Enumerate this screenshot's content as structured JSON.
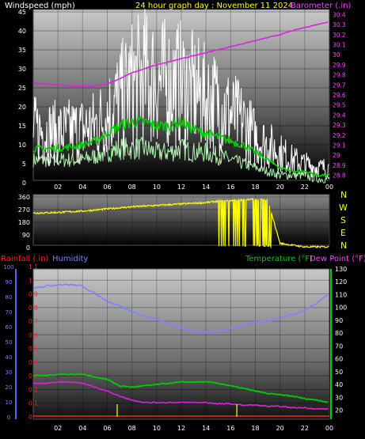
{
  "header": {
    "left_label": "Windspeed (mph)",
    "center_label": "24 hour graph day : November 11 2024",
    "right_label": "Barometer (.in)"
  },
  "mid": {
    "compass_labels": [
      "N",
      "W",
      "S",
      "E",
      "N"
    ]
  },
  "bottom": {
    "rain_label": "Rainfall (.in)",
    "hum_label": "Humidity",
    "temp_label": "Temperature (°F)",
    "dew_label": "Dew Point (°F)"
  },
  "colors": {
    "wind_gust": "#ffffff",
    "wind_avg": "#00cc00",
    "wind_low": "#b0f0b0",
    "barometer": "#e020e0",
    "direction": "#ffff00",
    "humidity": "#8080ff",
    "temperature": "#00cc00",
    "dewpoint": "#e020e0",
    "rain": "#ff2020",
    "rainbars": "#ffff00"
  },
  "chart_data": [
    {
      "type": "line",
      "title": "24 hour graph day : November 11 2024",
      "x_ticks": [
        "02",
        "04",
        "06",
        "08",
        "10",
        "12",
        "14",
        "16",
        "18",
        "20",
        "22",
        "00"
      ],
      "left_axis": {
        "label": "Windspeed (mph)",
        "ticks": [
          0,
          5,
          10,
          15,
          20,
          25,
          30,
          35,
          40,
          45
        ],
        "range": [
          0,
          45
        ]
      },
      "right_axis": {
        "label": "Barometer (.in)",
        "ticks": [
          28.8,
          28.9,
          29,
          29.1,
          29.2,
          29.3,
          29.4,
          29.5,
          29.6,
          29.7,
          29.8,
          29.9,
          30,
          30.1,
          30.2,
          30.3,
          30.4
        ],
        "range": [
          28.75,
          30.45
        ]
      },
      "series": [
        {
          "x": [
            0,
            2,
            4,
            5,
            6,
            7,
            8,
            9,
            10,
            11,
            12,
            13,
            14,
            15,
            16,
            17,
            18,
            19,
            20,
            21,
            22,
            23,
            24
          ],
          "values": [
            14,
            13,
            14,
            15,
            18,
            22,
            26,
            28,
            27,
            26,
            26,
            24,
            22,
            21,
            18,
            16,
            12,
            10,
            8,
            6,
            5,
            4,
            4
          ]
        },
        {
          "x": [
            0,
            2,
            4,
            5,
            6,
            7,
            8,
            9,
            10,
            11,
            12,
            13,
            14,
            15,
            16,
            17,
            18,
            19,
            20,
            21,
            22,
            23,
            24
          ],
          "values": [
            9,
            9,
            10,
            11,
            13,
            15,
            16,
            16,
            15,
            15,
            16,
            14,
            13,
            12,
            11,
            10,
            8,
            6,
            4,
            3,
            3,
            2,
            2
          ]
        },
        {
          "x": [
            0,
            2,
            4,
            5,
            6,
            7,
            8,
            9,
            10,
            11,
            12,
            13,
            14,
            15,
            16,
            17,
            18,
            19,
            20,
            21,
            22,
            23,
            24
          ],
          "values": [
            6,
            6,
            6,
            7,
            8,
            9,
            9,
            9,
            8,
            8,
            9,
            8,
            8,
            7,
            6,
            5,
            4,
            3,
            2,
            2,
            2,
            1,
            1
          ]
        },
        {
          "x": [
            0,
            1,
            2,
            3,
            4,
            5,
            6,
            7,
            8,
            9,
            10,
            11,
            12,
            13,
            14,
            15,
            16,
            17,
            18,
            19,
            20,
            21,
            22,
            23,
            24
          ],
          "values": [
            29.72,
            29.71,
            29.7,
            29.69,
            29.69,
            29.69,
            29.71,
            29.76,
            29.82,
            29.86,
            29.9,
            29.93,
            29.96,
            29.99,
            30.02,
            30.05,
            30.08,
            30.11,
            30.14,
            30.17,
            30.2,
            30.24,
            30.27,
            30.3,
            30.33
          ]
        }
      ]
    },
    {
      "type": "line",
      "x_ticks": [
        "02",
        "04",
        "06",
        "08",
        "10",
        "12",
        "14",
        "16",
        "18",
        "20",
        "22",
        "00"
      ],
      "left_axis": {
        "ticks": [
          0,
          90,
          180,
          270,
          360
        ],
        "range": [
          0,
          360
        ]
      },
      "right_axis": {
        "ticks": [
          "N",
          "W",
          "S",
          "E",
          "N"
        ]
      },
      "series": [
        {
          "x": [
            0,
            2,
            4,
            6,
            8,
            10,
            12,
            14,
            15,
            16,
            17,
            18,
            19,
            20,
            22,
            24
          ],
          "values": [
            245,
            250,
            260,
            275,
            290,
            300,
            310,
            320,
            330,
            335,
            340,
            345,
            340,
            30,
            5,
            5
          ]
        }
      ]
    },
    {
      "type": "line",
      "x_ticks": [
        "02",
        "04",
        "06",
        "08",
        "10",
        "12",
        "14",
        "16",
        "18",
        "20",
        "22",
        "00"
      ],
      "left_axis": {
        "label": "Rainfall (.in) / Humidity",
        "humidity_ticks": [
          0,
          10,
          20,
          30,
          40,
          50,
          60,
          70,
          80,
          90,
          100
        ],
        "rain_ticks": [
          0,
          0.1,
          0.2,
          0.3,
          0.4,
          0.5,
          0.6,
          0.7,
          0.8,
          0.9,
          1,
          1.1
        ],
        "range": [
          0,
          100
        ]
      },
      "right_axis": {
        "label": "Temperature (°F) Dew Point (°F)",
        "ticks": [
          20,
          30,
          40,
          50,
          60,
          70,
          80,
          90,
          100,
          110,
          120,
          130
        ],
        "range": [
          13,
          130
        ]
      },
      "series": [
        {
          "x": [
            0,
            1,
            2,
            3,
            4,
            5,
            6,
            7,
            8,
            9,
            10,
            11,
            12,
            13,
            14,
            15,
            16,
            17,
            18,
            19,
            20,
            21,
            22,
            23,
            24
          ],
          "values": [
            86,
            87,
            88,
            88,
            87,
            82,
            77,
            74,
            70,
            67,
            65,
            62,
            59,
            57,
            56,
            57,
            59,
            61,
            63,
            64,
            66,
            68,
            71,
            76,
            82
          ]
        },
        {
          "x": [
            0,
            1,
            2,
            3,
            4,
            5,
            6,
            7,
            8,
            9,
            10,
            11,
            12,
            13,
            14,
            15,
            16,
            17,
            18,
            19,
            20,
            21,
            22,
            23,
            24
          ],
          "values": [
            47,
            47,
            48,
            48,
            48,
            46,
            44,
            39,
            38,
            39,
            40,
            41,
            42,
            42,
            42,
            41,
            39,
            37,
            35,
            33,
            32,
            31,
            29,
            28,
            26
          ]
        },
        {
          "x": [
            0,
            1,
            2,
            3,
            4,
            5,
            6,
            7,
            8,
            9,
            10,
            11,
            12,
            13,
            14,
            15,
            16,
            17,
            18,
            19,
            20,
            21,
            22,
            23,
            24
          ],
          "values": [
            41,
            41,
            42,
            42,
            41,
            38,
            35,
            31,
            28,
            26,
            26,
            26,
            26,
            26,
            26,
            25,
            25,
            24,
            24,
            23,
            23,
            22,
            22,
            21,
            21
          ]
        },
        {
          "x": [
            6.8,
            16.5
          ],
          "values": [
            0.02,
            0.02
          ]
        }
      ]
    }
  ]
}
